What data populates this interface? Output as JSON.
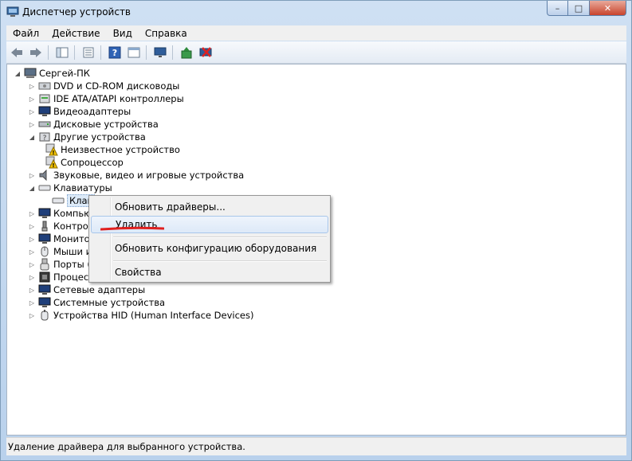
{
  "window": {
    "title": "Диспетчер устройств",
    "controls": {
      "minimize": "–",
      "maximize": "□",
      "close": "✕"
    }
  },
  "menubar": [
    "Файл",
    "Действие",
    "Вид",
    "Справка"
  ],
  "toolbar": {
    "buttons": [
      "back-icon",
      "forward-icon",
      "show-hide-tree-icon",
      "properties-icon",
      "help-icon",
      "view-icon",
      "monitor-scan-icon",
      "update-driver-icon",
      "uninstall-icon"
    ]
  },
  "tree": {
    "root": "Сергей-ПК",
    "items": [
      "DVD и CD-ROM дисководы",
      "IDE ATA/ATAPI контроллеры",
      "Видеоадаптеры",
      "Дисковые устройства",
      "Другие устройства",
      "Неизвестное устройство",
      "Сопроцессор",
      "Звуковые, видео и игровые устройства",
      "Клавиатуры",
      "Клав",
      "Компью",
      "Контрол",
      "Монито",
      "Мыши и",
      "Порты (",
      "Процесс",
      "Сетевые адаптеры",
      "Системные устройства",
      "Устройства HID (Human Interface Devices)"
    ]
  },
  "context_menu": {
    "items": [
      "Обновить драйверы...",
      "Удалить",
      "Обновить конфигурацию оборудования",
      "Свойства"
    ],
    "highlighted": "Удалить"
  },
  "status": "Удаление драйвера для выбранного устройства.",
  "colors": {
    "selection_border": "#a8c6ea",
    "annotation_red": "#e02020"
  }
}
